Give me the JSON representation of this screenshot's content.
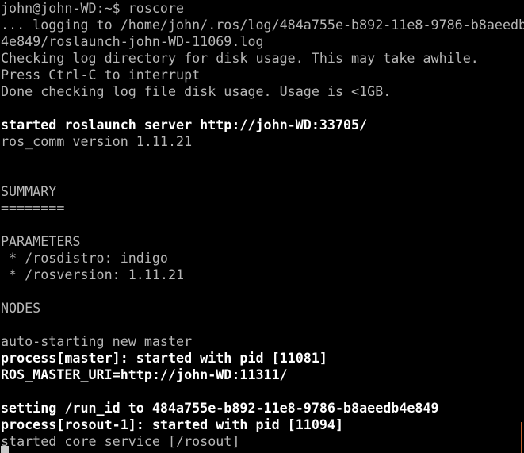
{
  "terminal": {
    "background_color": "#000000",
    "normal_text_color": "#b7b7b7",
    "bold_text_color": "#ffffff",
    "accent_color": "#c4612e",
    "cursor_color": "#c9c9c9",
    "prompt": "john@john-WD:~$",
    "command": "roscore",
    "lines": [
      {
        "text": "john@john-WD:~$ roscore",
        "bold": false
      },
      {
        "text": "... logging to /home/john/.ros/log/484a755e-b892-11e8-9786-b8aeedb",
        "bold": false
      },
      {
        "text": "4e849/roslaunch-john-WD-11069.log",
        "bold": false
      },
      {
        "text": "Checking log directory for disk usage. This may take awhile.",
        "bold": false
      },
      {
        "text": "Press Ctrl-C to interrupt",
        "bold": false
      },
      {
        "text": "Done checking log file disk usage. Usage is <1GB.",
        "bold": false
      },
      {
        "text": "",
        "bold": false
      },
      {
        "text": "started roslaunch server http://john-WD:33705/",
        "bold": true
      },
      {
        "text": "ros_comm version 1.11.21",
        "bold": false
      },
      {
        "text": "",
        "bold": false
      },
      {
        "text": "",
        "bold": false
      },
      {
        "text": "SUMMARY",
        "bold": false
      },
      {
        "text": "========",
        "bold": false
      },
      {
        "text": "",
        "bold": false
      },
      {
        "text": "PARAMETERS",
        "bold": false
      },
      {
        "text": " * /rosdistro: indigo",
        "bold": false
      },
      {
        "text": " * /rosversion: 1.11.21",
        "bold": false
      },
      {
        "text": "",
        "bold": false
      },
      {
        "text": "NODES",
        "bold": false
      },
      {
        "text": "",
        "bold": false
      },
      {
        "text": "auto-starting new master",
        "bold": false
      },
      {
        "text": "process[master]: started with pid [11081]",
        "bold": true
      },
      {
        "text": "ROS_MASTER_URI=http://john-WD:11311/",
        "bold": true
      },
      {
        "text": "",
        "bold": false
      },
      {
        "text": "setting /run_id to 484a755e-b892-11e8-9786-b8aeedb4e849",
        "bold": true
      },
      {
        "text": "process[rosout-1]: started with pid [11094]",
        "bold": true
      },
      {
        "text": "started core service [/rosout]",
        "bold": false
      }
    ],
    "log_path": "/home/john/.ros/log/484a755e-b892-11e8-9786-b8aeedb4e849/roslaunch-john-WD-11069.log",
    "roslaunch_server_uri": "http://john-WD:33705/",
    "ros_master_uri": "http://john-WD:11311/",
    "ros_comm_version": "1.11.21",
    "rosdistro": "indigo",
    "rosversion": "1.11.21",
    "run_id": "484a755e-b892-11e8-9786-b8aeedb4e849",
    "master_pid": "11081",
    "rosout_pid": "11094",
    "disk_usage": "<1GB"
  }
}
